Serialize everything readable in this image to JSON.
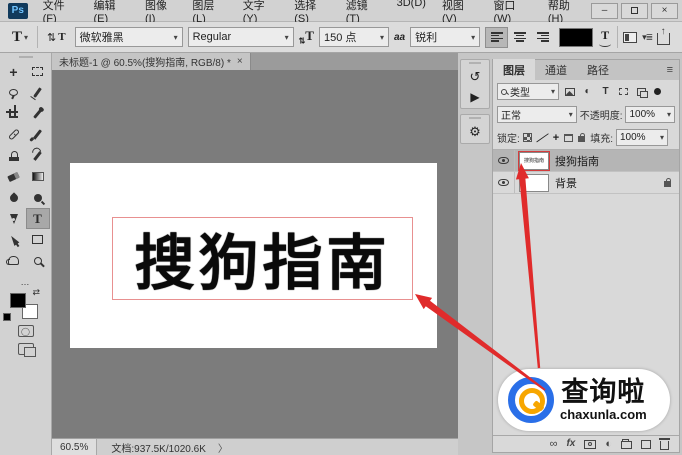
{
  "titlebar": {
    "logo": "Ps",
    "menus": [
      "文件(F)",
      "编辑(E)",
      "图像(I)",
      "图层(L)",
      "文字(Y)",
      "选择(S)",
      "滤镜(T)",
      "3D(D)",
      "视图(V)",
      "窗口(W)",
      "帮助(H)"
    ],
    "controls": {
      "minimize": "–",
      "close": "×"
    }
  },
  "options": {
    "tool_letter": "T",
    "orientation_icon": "⇅",
    "font_family": "微软雅黑",
    "font_style": "Regular",
    "size_icon": "T",
    "font_size": "150 点",
    "anti_alias_icon": "aa",
    "anti_alias": "锐利",
    "warp_letter": "T"
  },
  "toolbar": {
    "tools": [
      "move",
      "rectangular-marquee",
      "lasso",
      "quick-selection",
      "crop",
      "eyedropper",
      "spot-healing",
      "brush",
      "clone-stamp",
      "history-brush",
      "eraser",
      "gradient",
      "blur",
      "dodge",
      "pen",
      "horizontal-type",
      "path-selection",
      "rectangle",
      "hand",
      "zoom"
    ],
    "more_dots": "…",
    "type_letter": "T"
  },
  "document": {
    "tab_title": "未标题-1 @ 60.5%(搜狗指南, RGB/8) *",
    "tab_close": "×",
    "canvas_text": "搜狗指南",
    "zoom_level": "60.5%",
    "doc_info": "文档:937.5K/1020.6K",
    "chevron": "〉"
  },
  "dock": {
    "history_icon": "↺",
    "actions_icon": "▶",
    "properties_icon": "⚙"
  },
  "layers_panel": {
    "tabs": [
      "图层",
      "通道",
      "路径"
    ],
    "panel_menu": "≡",
    "filter_label": "类型",
    "filter_type_letter": "T",
    "adjustment_glyph": "◐",
    "blend_mode": "正常",
    "opacity_label": "不透明度:",
    "opacity_value": "100%",
    "lock_label": "锁定:",
    "lock_brush": "／",
    "lock_move": "✛",
    "fill_label": "填充:",
    "fill_value": "100%",
    "layers": [
      {
        "name": "搜狗指南",
        "thumb_text": "搜狗指南"
      },
      {
        "name": "背景"
      }
    ],
    "footer": {
      "link": "∞",
      "fx": "fx",
      "adjustment": "◐"
    }
  },
  "watermark": {
    "title": "查询啦",
    "domain": "chaxunla.com"
  },
  "colors": {
    "accent_red": "#e02b2b",
    "logo_blue": "#2a6fe8",
    "logo_orange": "#f7a600",
    "canvas_gray": "#7c7c7c"
  }
}
